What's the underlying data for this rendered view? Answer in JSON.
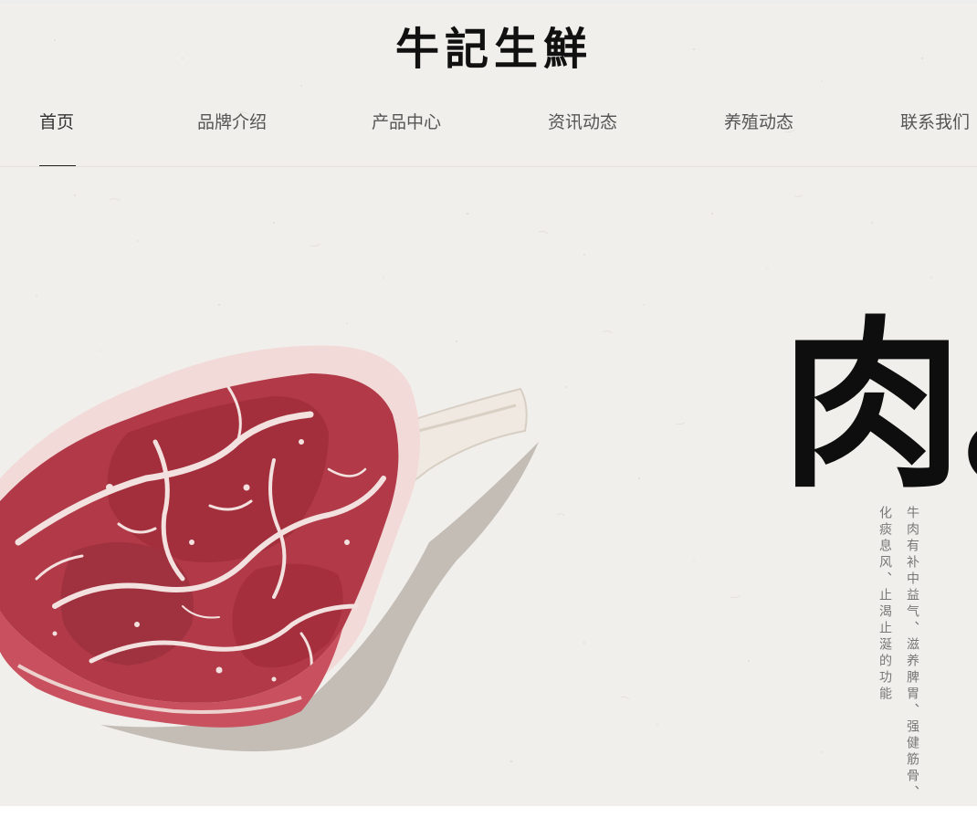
{
  "logo": {
    "text": "牛記生鮮"
  },
  "nav": {
    "items": [
      {
        "label": "首页",
        "active": true
      },
      {
        "label": "品牌介绍",
        "active": false
      },
      {
        "label": "产品中心",
        "active": false
      },
      {
        "label": "资讯动态",
        "active": false
      },
      {
        "label": "养殖动态",
        "active": false
      },
      {
        "label": "联系我们",
        "active": false
      }
    ]
  },
  "hero": {
    "calligraphy": "肉。",
    "column1": "牛肉有补中益气、滋养脾胃、强健筋骨、",
    "column2": "化痰息风、止渴止涎的功能"
  },
  "colors": {
    "background": "#f1efeb",
    "nav_text": "#555555",
    "active_underline": "#222222",
    "ink": "#0e0e0e",
    "meat_red": "#b23a48"
  }
}
